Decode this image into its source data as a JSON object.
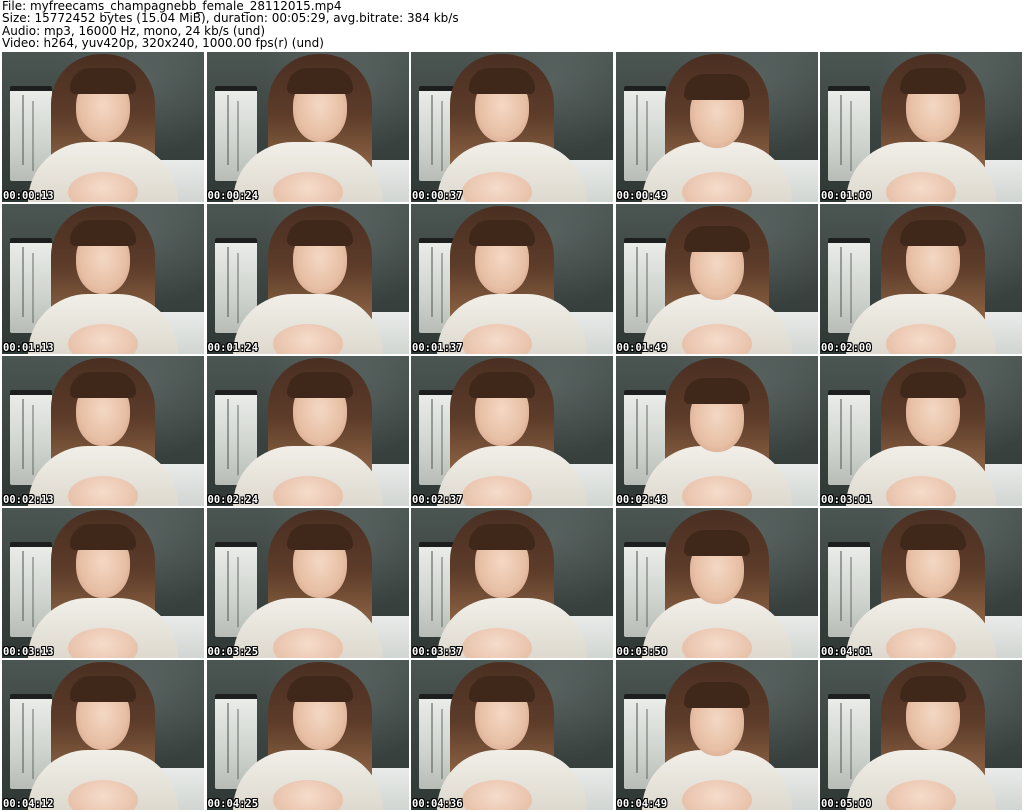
{
  "header": {
    "file_line": "File: myfreecams_champagnebb_female_28112015.mp4",
    "size_line": "Size: 15772452 bytes (15.04 MiB), duration: 00:05:29, avg.bitrate: 384 kb/s",
    "audio_line": "Audio: mp3, 16000 Hz, mono, 24 kb/s (und)",
    "video_line": "Video: h264, yuv420p, 320x240, 1000.00 fps(r) (und)"
  },
  "thumbnails": [
    {
      "timestamp": "00:00:13"
    },
    {
      "timestamp": "00:00:24"
    },
    {
      "timestamp": "00:00:37"
    },
    {
      "timestamp": "00:00:49"
    },
    {
      "timestamp": "00:01:00"
    },
    {
      "timestamp": "00:01:13"
    },
    {
      "timestamp": "00:01:24"
    },
    {
      "timestamp": "00:01:37"
    },
    {
      "timestamp": "00:01:49"
    },
    {
      "timestamp": "00:02:00"
    },
    {
      "timestamp": "00:02:13"
    },
    {
      "timestamp": "00:02:24"
    },
    {
      "timestamp": "00:02:37"
    },
    {
      "timestamp": "00:02:48"
    },
    {
      "timestamp": "00:03:01"
    },
    {
      "timestamp": "00:03:13"
    },
    {
      "timestamp": "00:03:25"
    },
    {
      "timestamp": "00:03:37"
    },
    {
      "timestamp": "00:03:50"
    },
    {
      "timestamp": "00:04:01"
    },
    {
      "timestamp": "00:04:12"
    },
    {
      "timestamp": "00:04:25"
    },
    {
      "timestamp": "00:04:36"
    },
    {
      "timestamp": "00:04:49"
    },
    {
      "timestamp": "00:05:00"
    }
  ]
}
